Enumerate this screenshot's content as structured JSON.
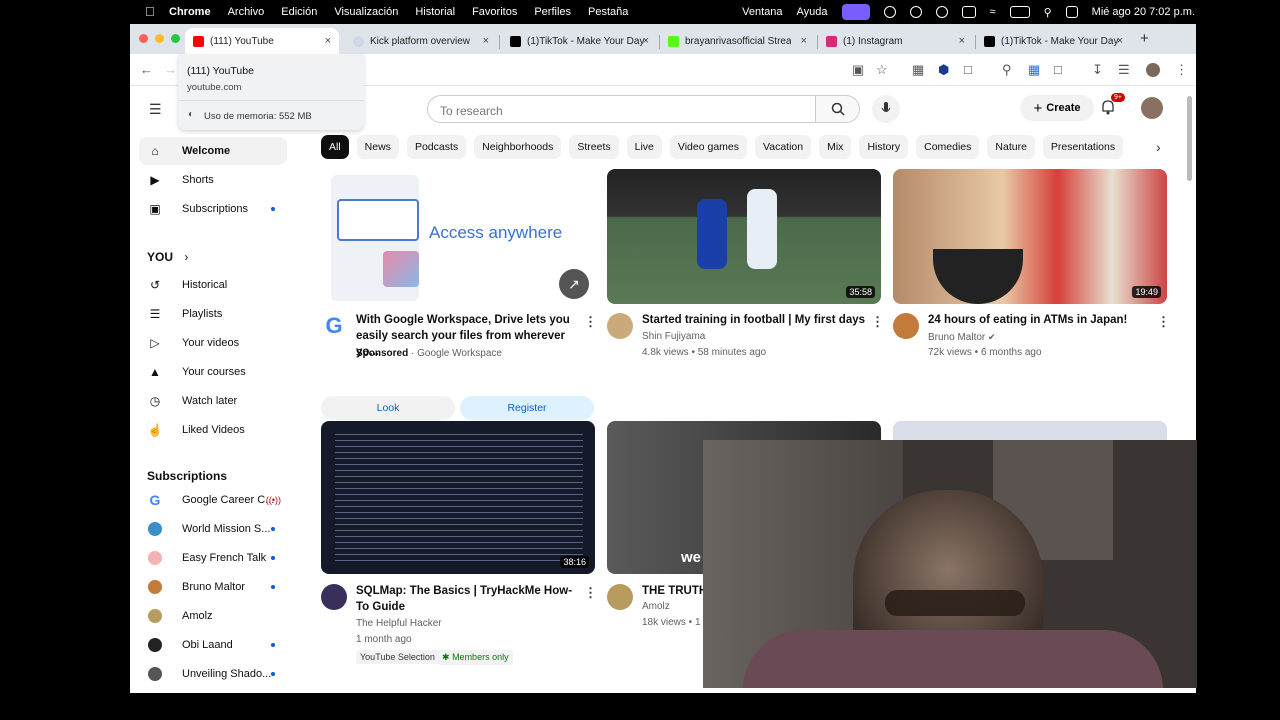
{
  "menubar": {
    "app": "Chrome",
    "items": [
      "Archivo",
      "Edición",
      "Visualización",
      "Historial",
      "Favoritos",
      "Perfiles",
      "Pestaña"
    ],
    "right_items": [
      "Ventana",
      "Ayuda"
    ],
    "datetime": "Mié ago 20  7:02 p.m."
  },
  "tabs": [
    {
      "title": "(111) YouTube",
      "color": "#ff0000"
    },
    {
      "title": "Kick platform overview",
      "color": "#cfd8e6"
    },
    {
      "title": "(1)TikTok - Make Your Day",
      "color": "#000000"
    },
    {
      "title": "brayanrivasofficial Stream",
      "color": "#53fc18"
    },
    {
      "title": "(1) Instagram",
      "color": "#d62976"
    },
    {
      "title": "(1)TikTok - Make Your Day",
      "color": "#000000"
    }
  ],
  "tooltip": {
    "title": "(111) YouTube",
    "url": "youtube.com",
    "memory": "Uso de memoria: 552 MB"
  },
  "youtube": {
    "search_placeholder": "To research",
    "create_label": "Create",
    "notif_badge": "9+",
    "sidebar": {
      "main": [
        {
          "label": "Welcome",
          "icon": "home-icon"
        },
        {
          "label": "Shorts",
          "icon": "shorts-icon"
        },
        {
          "label": "Subscriptions",
          "icon": "subscriptions-icon"
        }
      ],
      "you_header": "YOU",
      "you": [
        {
          "label": "Historical",
          "icon": "history-icon"
        },
        {
          "label": "Playlists",
          "icon": "playlists-icon"
        },
        {
          "label": "Your videos",
          "icon": "video-icon"
        },
        {
          "label": "Your courses",
          "icon": "courses-icon"
        },
        {
          "label": "Watch later",
          "icon": "clock-icon"
        },
        {
          "label": "Liked Videos",
          "icon": "thumbs-up-icon"
        }
      ],
      "subs_header": "Subscriptions",
      "subs": [
        {
          "label": "Google Career C...",
          "color": "#4285f4"
        },
        {
          "label": "World Mission S...",
          "color": "#3a8fc9"
        },
        {
          "label": "Easy French Talk",
          "color": "#f3b3b3"
        },
        {
          "label": "Bruno Maltor",
          "color": "#c47a3a"
        },
        {
          "label": "Amolz",
          "color": "#b89b5e"
        },
        {
          "label": "Obi Laand",
          "color": "#222222"
        },
        {
          "label": "Unveiling Shado...",
          "color": "#555555"
        }
      ]
    },
    "chips": [
      "All",
      "News",
      "Podcasts",
      "Neighborhoods",
      "Streets",
      "Live",
      "Video games",
      "Vacation",
      "Mix",
      "History",
      "Comedies",
      "Nature",
      "Presentations"
    ],
    "ad": {
      "headline": "Access anywhere",
      "title": "With Google Workspace, Drive lets you easily search your files from wherever yo...",
      "sponsored": "Sponsored",
      "advertiser": "Google Workspace",
      "btn_look": "Look",
      "btn_register": "Register"
    },
    "videos": [
      {
        "title": "Started training in football | My first days",
        "channel": "Shin Fujiyama",
        "meta": "4.8k views • 58 minutes ago",
        "duration": "35:58"
      },
      {
        "title": "24 hours of eating in ATMs in Japan!",
        "channel": "Bruno Maltor",
        "meta": "72k views • 6 months ago",
        "duration": "19:49"
      },
      {
        "title": "SQLMap: The Basics | TryHackMe How-To Guide",
        "channel": "The Helpful Hacker",
        "meta": "1 month ago",
        "duration": "38:16",
        "badge1": "YouTube Selection",
        "badge2": "Members only"
      },
      {
        "title": "THE TRUTH",
        "channel": "Amolz",
        "meta": "18k views • 1",
        "thumb_text": "we"
      }
    ]
  }
}
